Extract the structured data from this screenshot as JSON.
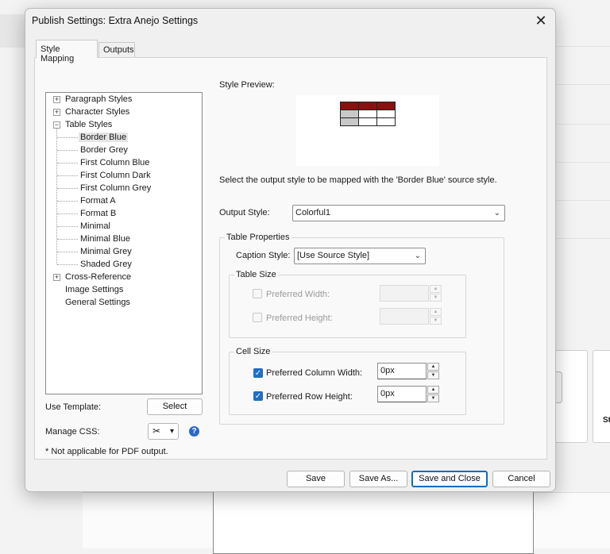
{
  "dialog": {
    "title": "Publish Settings: Extra Anejo Settings",
    "close_glyph": "✕"
  },
  "tabs": [
    {
      "label": "Style Mapping",
      "active": true
    },
    {
      "label": "Outputs",
      "active": false
    }
  ],
  "tree": {
    "expand_glyph": "+",
    "collapse_glyph": "−",
    "items": [
      {
        "label": "Paragraph Styles",
        "toggle": "collapsed"
      },
      {
        "label": "Character Styles",
        "toggle": "collapsed"
      },
      {
        "label": "Table Styles",
        "toggle": "expanded"
      },
      {
        "label": "Border Blue",
        "selected": true
      },
      {
        "label": "Border Grey"
      },
      {
        "label": "First Column Blue"
      },
      {
        "label": "First Column Dark"
      },
      {
        "label": "First Column Grey"
      },
      {
        "label": "Format A"
      },
      {
        "label": "Format B"
      },
      {
        "label": "Minimal"
      },
      {
        "label": "Minimal Blue"
      },
      {
        "label": "Minimal Grey"
      },
      {
        "label": "Shaded Grey"
      },
      {
        "label": "Cross-Reference",
        "toggle": "collapsed"
      },
      {
        "label": "Image Settings"
      },
      {
        "label": "General Settings"
      }
    ]
  },
  "left_controls": {
    "use_template_label": "Use Template:",
    "select_button": "Select",
    "manage_css_label": "Manage CSS:",
    "css_icon_glyph": "✂",
    "css_dropdown_glyph": "▾",
    "help_glyph": "?",
    "footnote": "* Not applicable for PDF output."
  },
  "preview": {
    "label": "Style Preview:",
    "header_color": "#8b0f0f",
    "first_column_color": "#c8c8c8"
  },
  "instruction": "Select the output style to be mapped with the 'Border Blue' source style.",
  "output_style": {
    "label": "Output Style:",
    "value": "Colorful1",
    "chevron": "⌄"
  },
  "table_properties": {
    "title": "Table Properties",
    "caption_label": "Caption Style:",
    "caption_value": "[Use Source Style]",
    "chevron": "⌄",
    "table_size": {
      "title": "Table Size",
      "width_label": "Preferred Width:",
      "height_label": "Preferred Height:",
      "width_value": "",
      "height_value": "",
      "enabled": false
    },
    "cell_size": {
      "title": "Cell Size",
      "col_width_label": "Preferred Column Width:",
      "row_height_label": "Preferred Row Height:",
      "col_width_value": "0px",
      "row_height_value": "0px",
      "check_glyph": "✓",
      "col_width_checked": true,
      "row_height_checked": true
    }
  },
  "spin": {
    "up": "▲",
    "down": "▼"
  },
  "buttons": {
    "save": "Save",
    "save_as": "Save As...",
    "save_close": "Save and Close",
    "cancel": "Cancel"
  },
  "background": {
    "card_text": "St"
  }
}
